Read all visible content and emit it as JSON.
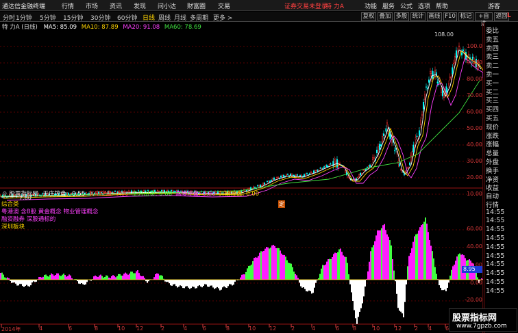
{
  "menubar": {
    "app_title": "通达信金融终端",
    "items": [
      "行情",
      "市场",
      "资讯",
      "发现",
      "问小达",
      "财富圈",
      "交易"
    ],
    "account_status": "证券交易未登录",
    "stock_label": "特 力A",
    "right_items": [
      "功能",
      "服务",
      "公式",
      "选项",
      "帮助"
    ],
    "guest": "游客"
  },
  "toolbar": {
    "periods": [
      "分时",
      "1分钟",
      "5分钟",
      "15分钟",
      "30分钟",
      "60分钟",
      "日线",
      "周线",
      "月线",
      "多周期",
      "更多 >"
    ],
    "active": "日线",
    "right_buttons": [
      "复权",
      "叠加",
      "多股",
      "统计",
      "画线",
      "F10",
      "标记",
      "+自选",
      "返回"
    ]
  },
  "info": {
    "stock": "特 力A (日线)",
    "ma5": "MA5: 85.09",
    "ma10": "MA10: 87.89",
    "ma20": "MA20: 91.08",
    "ma60": "MA60: 78.69",
    "colors": {
      "ma5": "#ffffff",
      "ma10": "#ffd400",
      "ma20": "#ff40ff",
      "ma60": "#40e040"
    }
  },
  "price_axis": [
    "100.0",
    "90.00",
    "80.00",
    "70.00",
    "60.00",
    "50.00",
    "40.00",
    "30.00",
    "20.00",
    "10.00"
  ],
  "high_label": "108.00",
  "low_label": "7.60",
  "indicator": {
    "title": "股票指标网",
    "values": [
      {
        "label": "无庄控盘: -9.55",
        "color": "#ffffff"
      },
      {
        "label": "有庄控盘: 0.00",
        "color": "#ff4040"
      },
      {
        "label": "主力出货: 0.00",
        "color": "#40ff40"
      },
      {
        "label": "高度控盘: 0.00",
        "color": "#ff40ff"
      },
      {
        "label": "开始控盘: 0.00",
        "color": "#ffd400"
      }
    ],
    "axis": [
      "60.00",
      "40.00",
      "20.00",
      "0.00",
      "-20.00"
    ],
    "current_value": "8.95",
    "tags": [
      {
        "label": "综合类",
        "color": "#ffd400"
      },
      {
        "label": "粤港澳 含B股 黄金概念 物业管理概念",
        "color": "#ff40ff"
      },
      {
        "label": "融资融券 深股通标的",
        "color": "#ff40ff"
      },
      {
        "label": "深圳板块",
        "color": "#ffd400"
      }
    ]
  },
  "x_axis": [
    "2014年",
    "4",
    "6",
    "8",
    "10",
    "12",
    "2",
    "4",
    "6",
    "8",
    "10",
    "12",
    "2",
    "4",
    "6",
    "8",
    "10",
    "12",
    "2",
    "4",
    "6",
    "8",
    "11"
  ],
  "right_panel": {
    "items": [
      "委比",
      "卖五",
      "卖四",
      "卖三",
      "卖二",
      "卖一",
      "买一",
      "买二",
      "买三",
      "买四",
      "买五",
      "现价",
      "涨跌",
      "涨幅",
      "总量",
      "外盘",
      "换手",
      "净资",
      "收益"
    ],
    "items2": [
      "自动",
      "行情",
      "14:55",
      "14:55",
      "14:55",
      "14:55",
      "14:55",
      "14:55",
      "14:55",
      "14:55",
      "14:55",
      "14:55"
    ],
    "top_letter": "L"
  },
  "watermark": {
    "title": "股票指标网",
    "url": "www.7gpzb.com"
  }
}
